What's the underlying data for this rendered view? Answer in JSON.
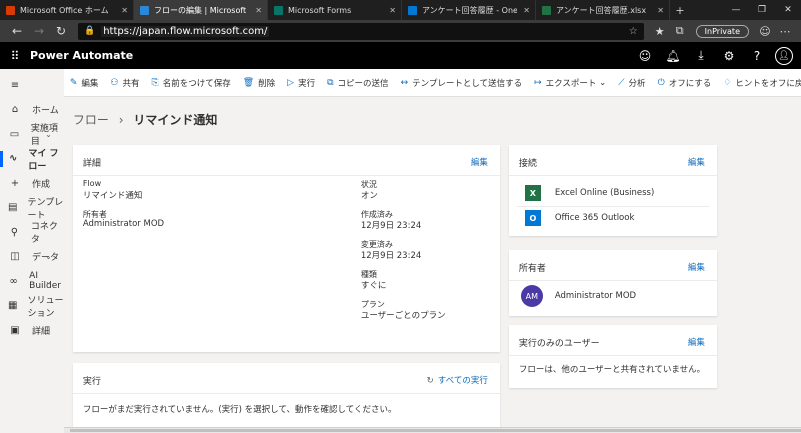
{
  "browser": {
    "tabs": [
      {
        "label": "Microsoft Office ホーム",
        "color": "#d83b01"
      },
      {
        "label": "フローの編集 | Microsoft Power Automate",
        "color": "#2b88d8"
      },
      {
        "label": "Microsoft Forms",
        "color": "#077568"
      },
      {
        "label": "アンケート回答履歴 - OneDrive",
        "color": "#0078d4"
      },
      {
        "label": "アンケート回答履歴.xlsx",
        "color": "#217346"
      }
    ],
    "url": "https://japan.flow.microsoft.com/",
    "inprivate": "InPrivate"
  },
  "app": {
    "name": "Power Automate"
  },
  "sidebar": {
    "items": [
      {
        "label": "ホーム",
        "icon": "⌂",
        "chev": ""
      },
      {
        "label": "実施項目",
        "icon": "▭",
        "chev": "⌄"
      },
      {
        "label": "マイ フロー",
        "icon": "∿",
        "chev": ""
      },
      {
        "label": "作成",
        "icon": "+",
        "chev": ""
      },
      {
        "label": "テンプレート",
        "icon": "▤",
        "chev": ""
      },
      {
        "label": "コネクタ",
        "icon": "⚲",
        "chev": ""
      },
      {
        "label": "データ",
        "icon": "◫",
        "chev": "⌄"
      },
      {
        "label": "AI Builder",
        "icon": "∞",
        "chev": "⌄"
      },
      {
        "label": "ソリューション",
        "icon": "▦",
        "chev": ""
      },
      {
        "label": "詳細",
        "icon": "▣",
        "chev": ""
      }
    ]
  },
  "cmdbar": {
    "items": [
      {
        "label": "編集",
        "icon": "✎"
      },
      {
        "label": "共有",
        "icon": "⚇"
      },
      {
        "label": "名前をつけて保存",
        "icon": "⎘"
      },
      {
        "label": "削除",
        "icon": "🗑"
      },
      {
        "label": "実行",
        "icon": "▷"
      },
      {
        "label": "コピーの送信",
        "icon": "⧉"
      },
      {
        "label": "テンプレートとして送信する",
        "icon": "↔"
      },
      {
        "label": "エクスポート",
        "icon": "↦"
      },
      {
        "label": "分析",
        "icon": "⟋"
      },
      {
        "label": "オフにする",
        "icon": "⏻"
      },
      {
        "label": "ヒントをオフに戻す",
        "icon": "♢"
      }
    ],
    "export_chev": "⌄"
  },
  "breadcrumb": {
    "root": "フロー",
    "sep": "›",
    "current": "リマインド通知"
  },
  "details": {
    "title": "詳細",
    "edit": "編集",
    "flow_label": "Flow",
    "flow_value": "リマインド通知",
    "owner_label": "所有者",
    "owner_value": "Administrator MOD",
    "status_label": "状況",
    "status_value": "オン",
    "created_label": "作成済み",
    "created_value": "12月9日 23:24",
    "modified_label": "変更済み",
    "modified_value": "12月9日 23:24",
    "type_label": "種類",
    "type_value": "すぐに",
    "plan_label": "プラン",
    "plan_value": "ユーザーごとのプラン"
  },
  "runs": {
    "title": "実行",
    "all_runs": "すべての実行",
    "empty_message": "フローがまだ実行されていません。(実行) を選択して、動作を確認してください。"
  },
  "connections": {
    "title": "接続",
    "edit": "編集",
    "items": [
      {
        "label": "Excel Online (Business)",
        "abbr": "X",
        "color": "#217346"
      },
      {
        "label": "Office 365 Outlook",
        "abbr": "O",
        "color": "#0078d4"
      }
    ]
  },
  "owners": {
    "title": "所有者",
    "edit": "編集",
    "initials": "AM",
    "name": "Administrator MOD"
  },
  "run_only": {
    "title": "実行のみのユーザー",
    "edit": "編集",
    "message": "フローは、他のユーザーと共有されていません。"
  }
}
